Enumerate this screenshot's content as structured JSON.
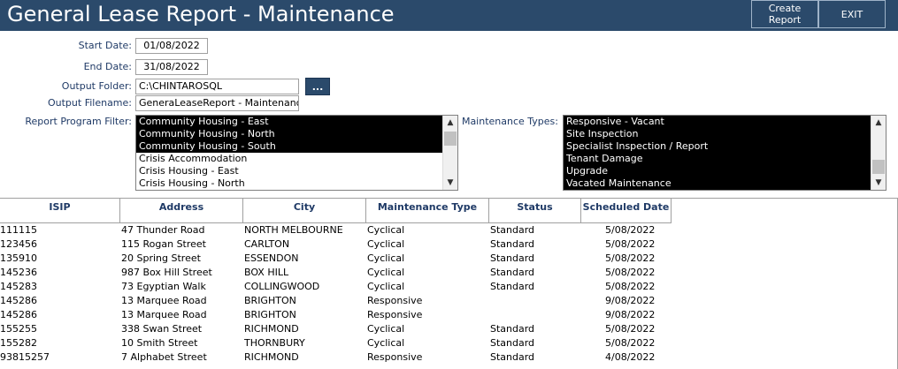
{
  "header": {
    "title": "General Lease Report - Maintenance",
    "create_label": "Create\nReport",
    "exit_label": "EXIT"
  },
  "form": {
    "start_date_label": "Start Date:",
    "start_date": "01/08/2022",
    "end_date_label": "End Date:",
    "end_date": "31/08/2022",
    "output_folder_label": "Output Folder:",
    "output_folder": "C:\\CHINTAROSQL",
    "browse_label": "...",
    "output_filename_label": "Output Filename:",
    "output_filename": "GeneraLeaseReport - Maintenance",
    "program_filter_label": "Report Program Filter:",
    "maintenance_types_label": "Maintenance Types:"
  },
  "program_filter": [
    {
      "label": "Community Housing - East",
      "selected": true
    },
    {
      "label": "Community Housing - North",
      "selected": true
    },
    {
      "label": "Community Housing - South",
      "selected": true
    },
    {
      "label": "Crisis Accommodation",
      "selected": false
    },
    {
      "label": "Crisis Housing - East",
      "selected": false
    },
    {
      "label": "Crisis Housing - North",
      "selected": false
    }
  ],
  "maintenance_types": [
    {
      "label": "Responsive - Vacant",
      "selected": true
    },
    {
      "label": "Site Inspection",
      "selected": true
    },
    {
      "label": "Specialist Inspection / Report",
      "selected": true
    },
    {
      "label": "Tenant Damage",
      "selected": true
    },
    {
      "label": "Upgrade",
      "selected": true
    },
    {
      "label": "Vacated Maintenance",
      "selected": true
    }
  ],
  "table": {
    "columns": [
      "ISIP",
      "Address",
      "City",
      "Maintenance Type",
      "Status",
      "Scheduled Date"
    ],
    "rows": [
      [
        "111115",
        "47 Thunder Road",
        "NORTH MELBOURNE",
        "Cyclical",
        "Standard",
        "5/08/2022"
      ],
      [
        "123456",
        "115 Rogan Street",
        "CARLTON",
        "Cyclical",
        "Standard",
        "5/08/2022"
      ],
      [
        "135910",
        "20 Spring Street",
        "ESSENDON",
        "Cyclical",
        "Standard",
        "5/08/2022"
      ],
      [
        "145236",
        "987 Box Hill Street",
        "BOX HILL",
        "Cyclical",
        "Standard",
        "5/08/2022"
      ],
      [
        "145283",
        "73 Egyptian Walk",
        "COLLINGWOOD",
        "Cyclical",
        "Standard",
        "5/08/2022"
      ],
      [
        "145286",
        "13 Marquee Road",
        "BRIGHTON",
        "Responsive",
        "",
        "9/08/2022"
      ],
      [
        "145286",
        "13 Marquee Road",
        "BRIGHTON",
        "Responsive",
        "",
        "9/08/2022"
      ],
      [
        "155255",
        "338 Swan Street",
        "RICHMOND",
        "Cyclical",
        "Standard",
        "5/08/2022"
      ],
      [
        "155282",
        "10 Smith Street",
        "THORNBURY",
        "Cyclical",
        "Standard",
        "5/08/2022"
      ],
      [
        "93815257",
        "7 Alphabet Street",
        "RICHMOND",
        "Responsive",
        "Standard",
        "4/08/2022"
      ]
    ]
  }
}
